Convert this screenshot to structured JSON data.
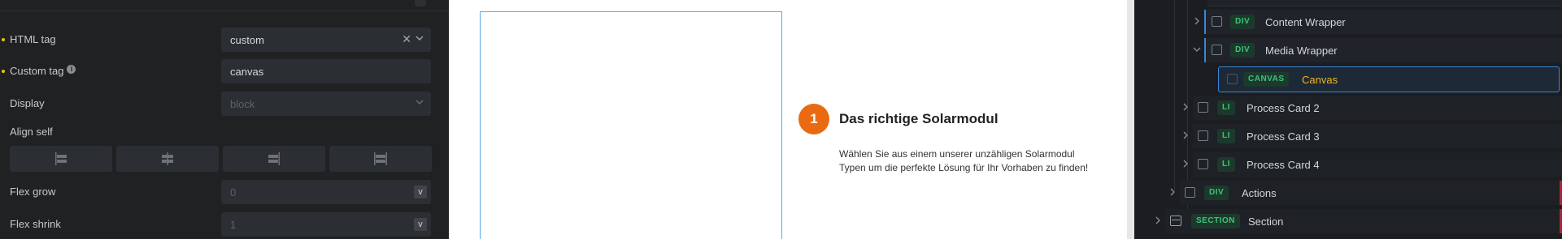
{
  "properties": {
    "html_tag": {
      "label": "HTML tag",
      "value": "custom"
    },
    "custom_tag": {
      "label": "Custom tag",
      "value": "canvas"
    },
    "display": {
      "label": "Display",
      "placeholder": "block"
    },
    "align_self": {
      "label": "Align self"
    },
    "flex_grow": {
      "label": "Flex grow",
      "placeholder": "0",
      "unit": "v"
    },
    "flex_shrink": {
      "label": "Flex shrink",
      "placeholder": "1",
      "unit": "v"
    }
  },
  "preview": {
    "step_number": "1",
    "title": "Das richtige Solarmodul",
    "description": "Wählen Sie aus einem unserer unzähligen Solarmodul Typen um die perfekte Lösung für Ihr Vorhaben zu finden!"
  },
  "navigator": {
    "items": [
      {
        "tag": "DIV",
        "name": "Content Wrapper"
      },
      {
        "tag": "DIV",
        "name": "Media Wrapper"
      },
      {
        "tag": "CANVAS",
        "name": "Canvas"
      },
      {
        "tag": "LI",
        "name": "Process Card 2"
      },
      {
        "tag": "LI",
        "name": "Process Card 3"
      },
      {
        "tag": "LI",
        "name": "Process Card 4"
      },
      {
        "tag": "DIV",
        "name": "Actions"
      },
      {
        "tag": "SECTION",
        "name": "Section"
      }
    ]
  },
  "colors": {
    "accent_orange": "#ea6a12",
    "selection_blue": "#3a86d8",
    "tag_green": "#3fc27a",
    "selected_name_yellow": "#f0b429",
    "changed_dot_yellow": "#f2c200"
  }
}
